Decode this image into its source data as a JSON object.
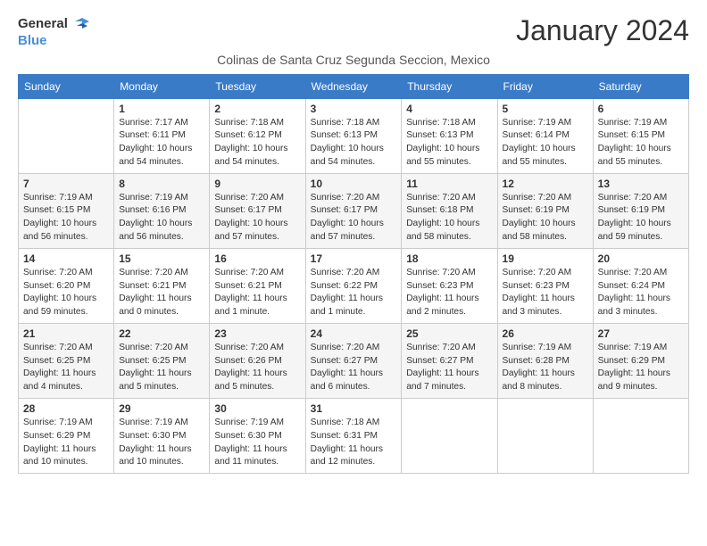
{
  "logo": {
    "general": "General",
    "blue": "Blue"
  },
  "title": "January 2024",
  "subtitle": "Colinas de Santa Cruz Segunda Seccion, Mexico",
  "headers": [
    "Sunday",
    "Monday",
    "Tuesday",
    "Wednesday",
    "Thursday",
    "Friday",
    "Saturday"
  ],
  "weeks": [
    [
      {
        "day": "",
        "info": ""
      },
      {
        "day": "1",
        "info": "Sunrise: 7:17 AM\nSunset: 6:11 PM\nDaylight: 10 hours\nand 54 minutes."
      },
      {
        "day": "2",
        "info": "Sunrise: 7:18 AM\nSunset: 6:12 PM\nDaylight: 10 hours\nand 54 minutes."
      },
      {
        "day": "3",
        "info": "Sunrise: 7:18 AM\nSunset: 6:13 PM\nDaylight: 10 hours\nand 54 minutes."
      },
      {
        "day": "4",
        "info": "Sunrise: 7:18 AM\nSunset: 6:13 PM\nDaylight: 10 hours\nand 55 minutes."
      },
      {
        "day": "5",
        "info": "Sunrise: 7:19 AM\nSunset: 6:14 PM\nDaylight: 10 hours\nand 55 minutes."
      },
      {
        "day": "6",
        "info": "Sunrise: 7:19 AM\nSunset: 6:15 PM\nDaylight: 10 hours\nand 55 minutes."
      }
    ],
    [
      {
        "day": "7",
        "info": "Sunrise: 7:19 AM\nSunset: 6:15 PM\nDaylight: 10 hours\nand 56 minutes."
      },
      {
        "day": "8",
        "info": "Sunrise: 7:19 AM\nSunset: 6:16 PM\nDaylight: 10 hours\nand 56 minutes."
      },
      {
        "day": "9",
        "info": "Sunrise: 7:20 AM\nSunset: 6:17 PM\nDaylight: 10 hours\nand 57 minutes."
      },
      {
        "day": "10",
        "info": "Sunrise: 7:20 AM\nSunset: 6:17 PM\nDaylight: 10 hours\nand 57 minutes."
      },
      {
        "day": "11",
        "info": "Sunrise: 7:20 AM\nSunset: 6:18 PM\nDaylight: 10 hours\nand 58 minutes."
      },
      {
        "day": "12",
        "info": "Sunrise: 7:20 AM\nSunset: 6:19 PM\nDaylight: 10 hours\nand 58 minutes."
      },
      {
        "day": "13",
        "info": "Sunrise: 7:20 AM\nSunset: 6:19 PM\nDaylight: 10 hours\nand 59 minutes."
      }
    ],
    [
      {
        "day": "14",
        "info": "Sunrise: 7:20 AM\nSunset: 6:20 PM\nDaylight: 10 hours\nand 59 minutes."
      },
      {
        "day": "15",
        "info": "Sunrise: 7:20 AM\nSunset: 6:21 PM\nDaylight: 11 hours\nand 0 minutes."
      },
      {
        "day": "16",
        "info": "Sunrise: 7:20 AM\nSunset: 6:21 PM\nDaylight: 11 hours\nand 1 minute."
      },
      {
        "day": "17",
        "info": "Sunrise: 7:20 AM\nSunset: 6:22 PM\nDaylight: 11 hours\nand 1 minute."
      },
      {
        "day": "18",
        "info": "Sunrise: 7:20 AM\nSunset: 6:23 PM\nDaylight: 11 hours\nand 2 minutes."
      },
      {
        "day": "19",
        "info": "Sunrise: 7:20 AM\nSunset: 6:23 PM\nDaylight: 11 hours\nand 3 minutes."
      },
      {
        "day": "20",
        "info": "Sunrise: 7:20 AM\nSunset: 6:24 PM\nDaylight: 11 hours\nand 3 minutes."
      }
    ],
    [
      {
        "day": "21",
        "info": "Sunrise: 7:20 AM\nSunset: 6:25 PM\nDaylight: 11 hours\nand 4 minutes."
      },
      {
        "day": "22",
        "info": "Sunrise: 7:20 AM\nSunset: 6:25 PM\nDaylight: 11 hours\nand 5 minutes."
      },
      {
        "day": "23",
        "info": "Sunrise: 7:20 AM\nSunset: 6:26 PM\nDaylight: 11 hours\nand 5 minutes."
      },
      {
        "day": "24",
        "info": "Sunrise: 7:20 AM\nSunset: 6:27 PM\nDaylight: 11 hours\nand 6 minutes."
      },
      {
        "day": "25",
        "info": "Sunrise: 7:20 AM\nSunset: 6:27 PM\nDaylight: 11 hours\nand 7 minutes."
      },
      {
        "day": "26",
        "info": "Sunrise: 7:19 AM\nSunset: 6:28 PM\nDaylight: 11 hours\nand 8 minutes."
      },
      {
        "day": "27",
        "info": "Sunrise: 7:19 AM\nSunset: 6:29 PM\nDaylight: 11 hours\nand 9 minutes."
      }
    ],
    [
      {
        "day": "28",
        "info": "Sunrise: 7:19 AM\nSunset: 6:29 PM\nDaylight: 11 hours\nand 10 minutes."
      },
      {
        "day": "29",
        "info": "Sunrise: 7:19 AM\nSunset: 6:30 PM\nDaylight: 11 hours\nand 10 minutes."
      },
      {
        "day": "30",
        "info": "Sunrise: 7:19 AM\nSunset: 6:30 PM\nDaylight: 11 hours\nand 11 minutes."
      },
      {
        "day": "31",
        "info": "Sunrise: 7:18 AM\nSunset: 6:31 PM\nDaylight: 11 hours\nand 12 minutes."
      },
      {
        "day": "",
        "info": ""
      },
      {
        "day": "",
        "info": ""
      },
      {
        "day": "",
        "info": ""
      }
    ]
  ]
}
